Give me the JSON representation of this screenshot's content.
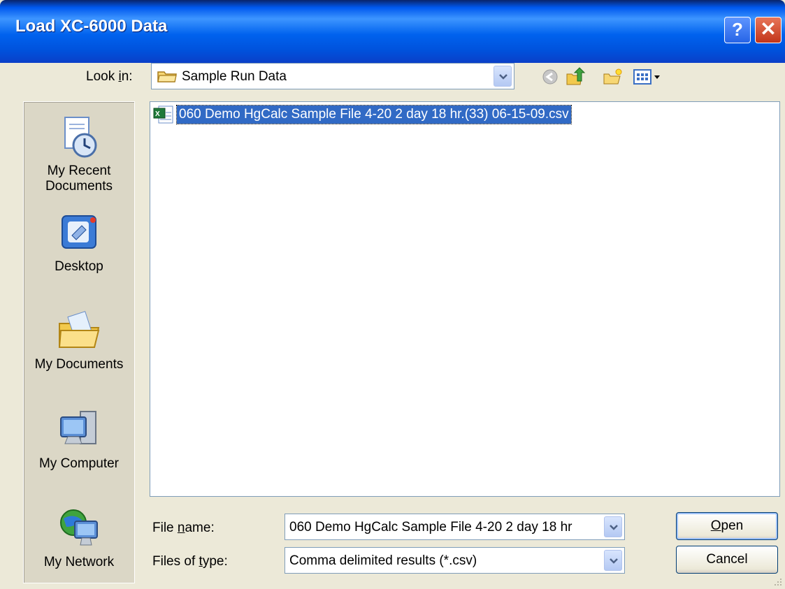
{
  "window": {
    "title": "Load XC-6000 Data",
    "help_glyph": "?",
    "close_glyph": "✕"
  },
  "lookin": {
    "label_pre": "Look ",
    "label_key": "i",
    "label_post": "n:",
    "value": "Sample Run Data"
  },
  "toolbar": {
    "icons": [
      "back-icon",
      "up-folder-icon",
      "new-folder-icon",
      "view-menu-icon"
    ]
  },
  "places": [
    {
      "label": "My Recent Documents",
      "label_line1": "My Recent",
      "label_line2": "Documents",
      "icon": "recent-documents-icon"
    },
    {
      "label": "Desktop",
      "icon": "desktop-icon"
    },
    {
      "label": "My Documents",
      "icon": "my-documents-icon"
    },
    {
      "label": "My Computer",
      "icon": "my-computer-icon"
    },
    {
      "label": "My Network",
      "icon": "my-network-icon"
    }
  ],
  "files": [
    {
      "name": "060 Demo HgCalc Sample File 4-20 2 day 18 hr.(33) 06-15-09.csv",
      "icon": "csv-file-icon",
      "selected": true
    }
  ],
  "filename": {
    "label_pre": "File ",
    "label_key": "n",
    "label_post": "ame:",
    "value": "060 Demo HgCalc Sample File 4-20 2 day 18 hr"
  },
  "filetype": {
    "label_pre": "Files of ",
    "label_key": "t",
    "label_post": "ype:",
    "value": "Comma delimited results (*.csv)"
  },
  "buttons": {
    "open_key": "O",
    "open_rest": "pen",
    "cancel": "Cancel"
  },
  "colors": {
    "titlebar": "#0058ee",
    "dialog_bg": "#ece9d8",
    "selection": "#316ac5"
  }
}
